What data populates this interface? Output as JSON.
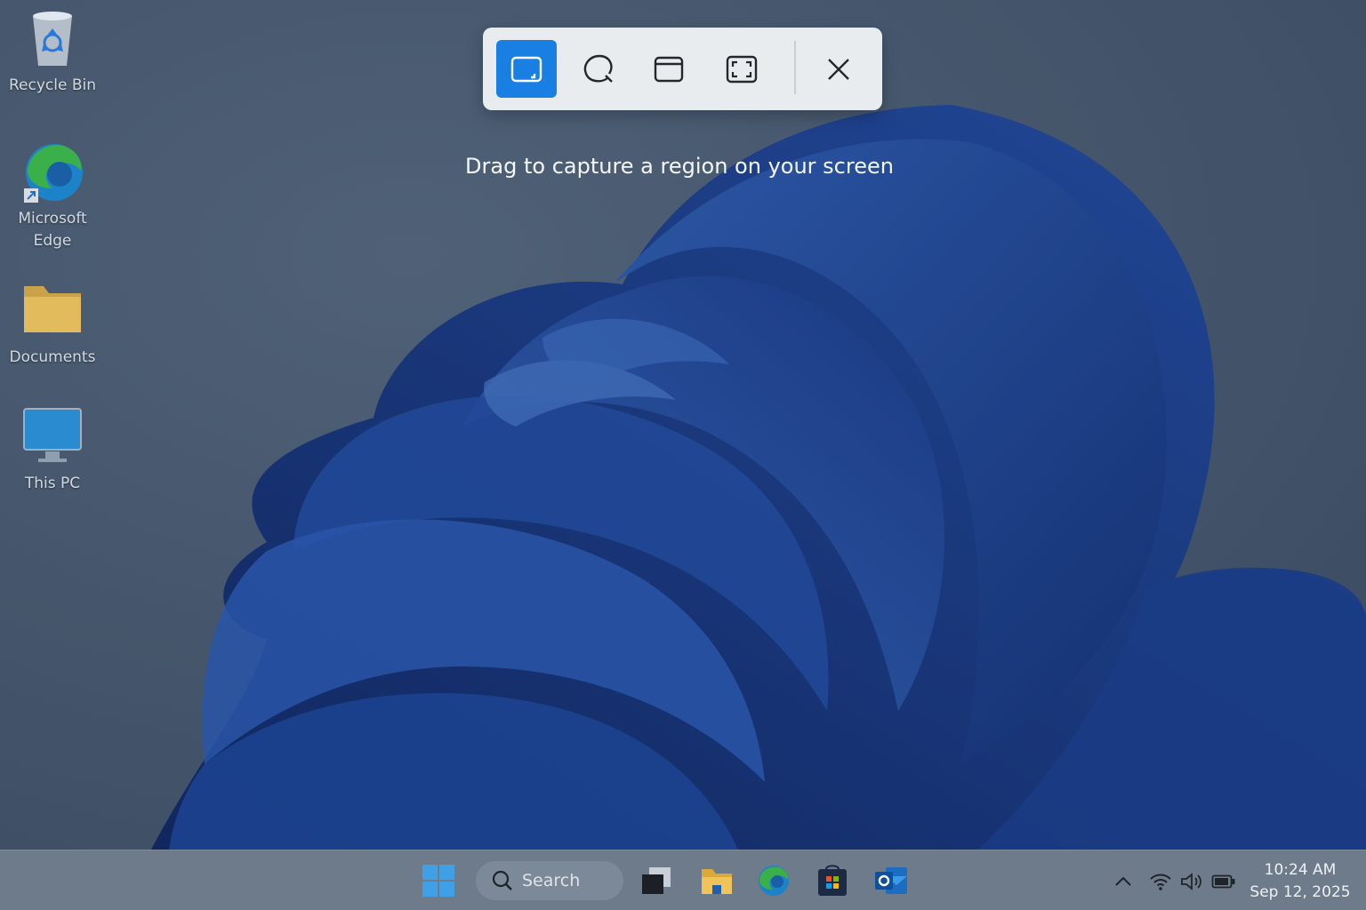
{
  "desktop": {
    "icons": [
      {
        "label": "Recycle Bin",
        "icon": "recycle-bin-icon"
      },
      {
        "label": "Microsoft\nEdge",
        "icon": "edge-icon"
      },
      {
        "label": "Documents",
        "icon": "folder-icon"
      },
      {
        "label": "This PC",
        "icon": "monitor-icon"
      }
    ]
  },
  "snipping_tool": {
    "modes": [
      {
        "name": "Rectangle mode",
        "icon": "rectangle-snip-icon",
        "selected": true
      },
      {
        "name": "Freeform mode",
        "icon": "freeform-snip-icon",
        "selected": false
      },
      {
        "name": "Window mode",
        "icon": "window-snip-icon",
        "selected": false
      },
      {
        "name": "Fullscreen mode",
        "icon": "fullscreen-snip-icon",
        "selected": false
      }
    ],
    "close_icon": "close-icon",
    "hint": "Drag to capture a region on your screen",
    "accent": "#1a7fe3"
  },
  "taskbar": {
    "search_label": "Search",
    "apps": [
      "start-icon",
      "task-view-icon",
      "file-explorer-icon",
      "edge-icon",
      "store-icon",
      "outlook-icon"
    ],
    "tray": [
      "chevron-up-icon",
      "wifi-icon",
      "speaker-icon",
      "battery-icon"
    ],
    "time": "10:24 AM",
    "date": "Sep 12, 2025"
  }
}
